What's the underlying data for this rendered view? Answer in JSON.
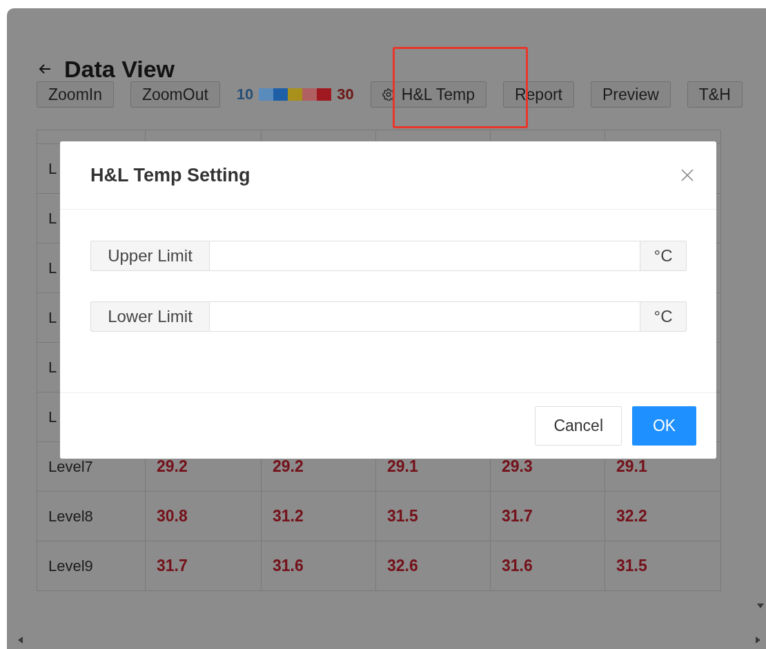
{
  "page": {
    "title": "Data View"
  },
  "toolbar": [
    {
      "kind": "button",
      "label": "ZoomIn"
    },
    {
      "kind": "button",
      "label": "ZoomOut"
    },
    {
      "kind": "legend",
      "min": "10",
      "max": "30",
      "swatches": [
        {
          "color": "#5a8bbd"
        },
        {
          "color": "#1e5fa8"
        },
        {
          "color": "#a8901a"
        },
        {
          "color": "#b06060"
        },
        {
          "color": "#a01820"
        }
      ]
    },
    {
      "kind": "iconbutton",
      "label": "H&L Temp",
      "highlighted": true
    },
    {
      "kind": "button",
      "label": "Report"
    },
    {
      "kind": "button",
      "label": "Preview"
    },
    {
      "kind": "button",
      "label": "T&H"
    }
  ],
  "table": {
    "rows": [
      {
        "label": "L",
        "values": []
      },
      {
        "label": "L",
        "values": []
      },
      {
        "label": "L",
        "values": []
      },
      {
        "label": "L",
        "values": []
      },
      {
        "label": "L",
        "values": []
      },
      {
        "label": "L",
        "values": []
      },
      {
        "label": "Level7",
        "values": [
          "29.2",
          "29.2",
          "29.1",
          "29.3",
          "29.1"
        ]
      },
      {
        "label": "Level8",
        "values": [
          "30.8",
          "31.2",
          "31.5",
          "31.7",
          "32.2"
        ]
      },
      {
        "label": "Level9",
        "values": [
          "31.7",
          "31.6",
          "32.6",
          "31.6",
          "31.5"
        ]
      }
    ]
  },
  "dialog": {
    "title": "H&L Temp Setting",
    "fields": [
      {
        "label": "Upper Limit",
        "unit": "°C"
      },
      {
        "label": "Lower Limit",
        "unit": "°C"
      }
    ],
    "buttons": [
      {
        "label": "Cancel",
        "kind": "default"
      },
      {
        "label": "OK",
        "kind": "primary"
      }
    ]
  }
}
